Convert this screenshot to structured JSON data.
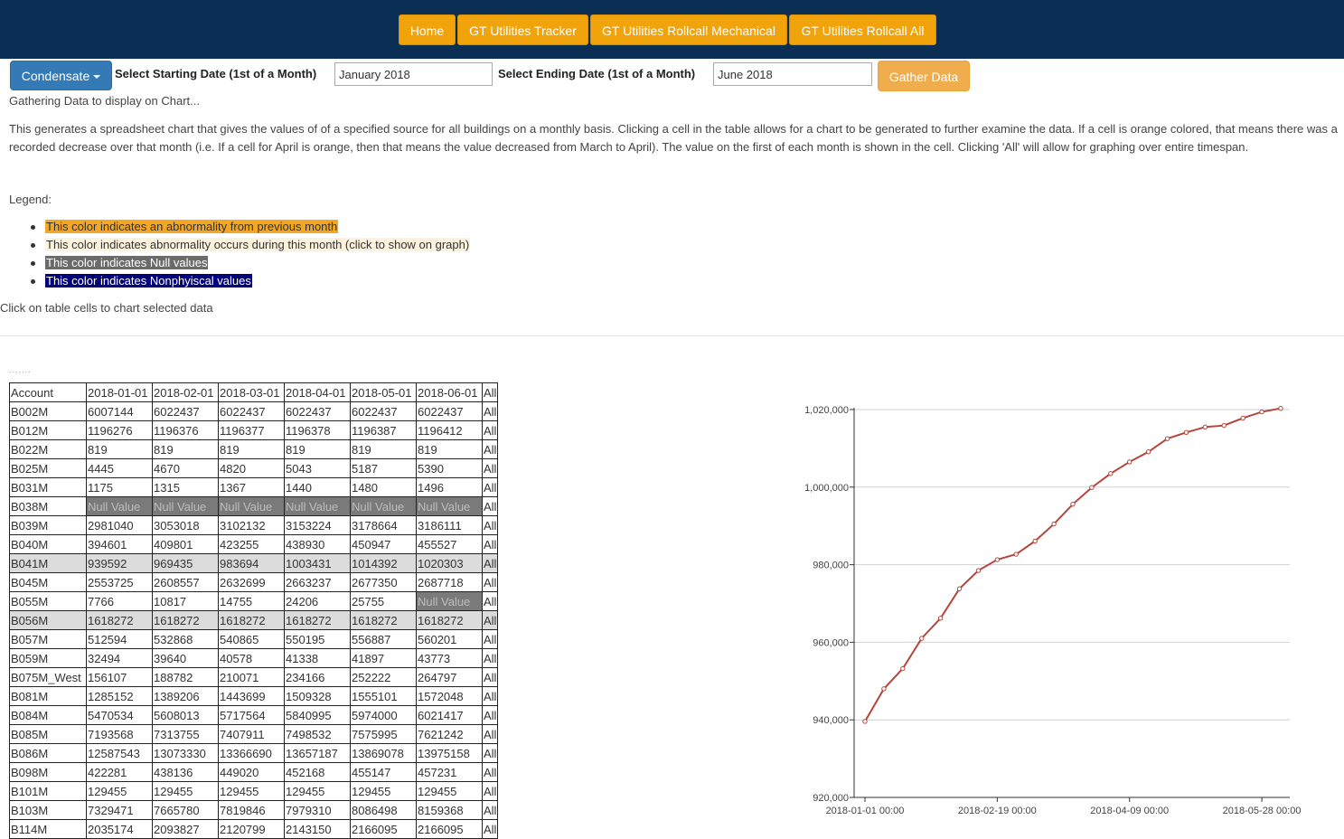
{
  "nav": {
    "items": [
      {
        "label": "Home"
      },
      {
        "label": "GT Utilities Tracker"
      },
      {
        "label": "GT Utilities Rollcall Mechanical"
      },
      {
        "label": "GT Utilities Rollcall All"
      }
    ]
  },
  "controls": {
    "condense_label": "Condensate",
    "start_label": "Select Starting Date (1st of a Month)",
    "start_value": "January 2018",
    "end_label": "Select Ending Date (1st of a Month)",
    "end_value": "June 2018",
    "gather_label": "Gather Data"
  },
  "status_text": "Gathering Data to display on Chart...",
  "description": "This generates a spreadsheet chart that gives the values of of a specified source for all buildings on a monthly basis. Clicking a cell in the table allows for a chart to be generated to further examine the data. If a cell is orange colored, that means there was a recorded decrease over that month (i.e. If a cell for April is orange, then that means the value decreased from March to April). The value on the first of each month is shown in the cell. Clicking 'All' will allow for graphing over entire timespan.",
  "legend": {
    "title": "Legend:",
    "items": [
      {
        "text": "This color indicates an abnormality from previous month",
        "bg": "#f5a623",
        "fg": "#333333"
      },
      {
        "text": "This color indicates abnormality occurs during this month (click to show on graph)",
        "bg": "#fdf3dc",
        "fg": "#333333"
      },
      {
        "text": "This color indicates Null values",
        "bg": "#6b6b6b",
        "fg": "#ffffff"
      },
      {
        "text": "This color indicates Nonphyiscal values",
        "bg": "#00007a",
        "fg": "#ffffff"
      }
    ]
  },
  "help_text": "Click on table cells to chart selected data",
  "table": {
    "headers": [
      "Account",
      "2018-01-01",
      "2018-02-01",
      "2018-03-01",
      "2018-04-01",
      "2018-05-01",
      "2018-06-01",
      "All"
    ],
    "rows": [
      {
        "account": "B002M",
        "values": [
          "6007144",
          "6022437",
          "6022437",
          "6022437",
          "6022437",
          "6022437"
        ],
        "all": "All"
      },
      {
        "account": "B012M",
        "values": [
          "1196276",
          "1196376",
          "1196377",
          "1196378",
          "1196387",
          "1196412"
        ],
        "all": "All"
      },
      {
        "account": "B022M",
        "values": [
          "819",
          "819",
          "819",
          "819",
          "819",
          "819"
        ],
        "all": "All"
      },
      {
        "account": "B025M",
        "values": [
          "4445",
          "4670",
          "4820",
          "5043",
          "5187",
          "5390"
        ],
        "all": "All"
      },
      {
        "account": "B031M",
        "values": [
          "1175",
          "1315",
          "1367",
          "1440",
          "1480",
          "1496"
        ],
        "all": "All"
      },
      {
        "account": "B038M",
        "values": [
          "Null Value",
          "Null Value",
          "Null Value",
          "Null Value",
          "Null Value",
          "Null Value"
        ],
        "all": "All"
      },
      {
        "account": "B039M",
        "values": [
          "2981040",
          "3053018",
          "3102132",
          "3153224",
          "3178664",
          "3186111"
        ],
        "all": "All"
      },
      {
        "account": "B040M",
        "values": [
          "394601",
          "409801",
          "423255",
          "438930",
          "450947",
          "455527"
        ],
        "all": "All"
      },
      {
        "account": "B041M",
        "values": [
          "939592",
          "969435",
          "983694",
          "1003431",
          "1014392",
          "1020303"
        ],
        "all": "All",
        "abnormal": true
      },
      {
        "account": "B045M",
        "values": [
          "2553725",
          "2608557",
          "2632699",
          "2663237",
          "2677350",
          "2687718"
        ],
        "all": "All"
      },
      {
        "account": "B055M",
        "values": [
          "7766",
          "10817",
          "14755",
          "24206",
          "25755",
          "Null Value"
        ],
        "all": "All"
      },
      {
        "account": "B056M",
        "values": [
          "1618272",
          "1618272",
          "1618272",
          "1618272",
          "1618272",
          "1618272"
        ],
        "all": "All",
        "abnormal": true
      },
      {
        "account": "B057M",
        "values": [
          "512594",
          "532868",
          "540865",
          "550195",
          "556887",
          "560201"
        ],
        "all": "All"
      },
      {
        "account": "B059M",
        "values": [
          "32494",
          "39640",
          "40578",
          "41338",
          "41897",
          "43773"
        ],
        "all": "All"
      },
      {
        "account": "B075M_West",
        "values": [
          "156107",
          "188782",
          "210071",
          "234166",
          "252222",
          "264797"
        ],
        "all": "All"
      },
      {
        "account": "B081M",
        "values": [
          "1285152",
          "1389206",
          "1443699",
          "1509328",
          "1555101",
          "1572048"
        ],
        "all": "All"
      },
      {
        "account": "B084M",
        "values": [
          "5470534",
          "5608013",
          "5717564",
          "5840995",
          "5974000",
          "6021417"
        ],
        "all": "All"
      },
      {
        "account": "B085M",
        "values": [
          "7193568",
          "7313755",
          "7407911",
          "7498532",
          "7575995",
          "7621242"
        ],
        "all": "All"
      },
      {
        "account": "B086M",
        "values": [
          "12587543",
          "13073330",
          "13366690",
          "13657187",
          "13869078",
          "13975158"
        ],
        "all": "All"
      },
      {
        "account": "B098M",
        "values": [
          "422281",
          "438136",
          "449020",
          "452168",
          "455147",
          "457231"
        ],
        "all": "All"
      },
      {
        "account": "B101M",
        "values": [
          "129455",
          "129455",
          "129455",
          "129455",
          "129455",
          "129455"
        ],
        "all": "All"
      },
      {
        "account": "B103M",
        "values": [
          "7329471",
          "7665780",
          "7819846",
          "7979310",
          "8086498",
          "8159368"
        ],
        "all": "All"
      },
      {
        "account": "B114M",
        "values": [
          "2035174",
          "2093827",
          "2120799",
          "2143150",
          "2166095",
          "2166095"
        ],
        "all": "All"
      }
    ]
  },
  "colors": {
    "nav_bg": "#0b2e55",
    "nav_button": "#f0a30a",
    "condense_button": "#337ab7",
    "gather_button": "#f0ad4e",
    "null_cell": "#7a7a7a",
    "abnormal_row": "#dcdcdc",
    "series_line": "#b5443a"
  },
  "chart_data": {
    "type": "line",
    "title": "",
    "xlabel": "",
    "ylabel": "",
    "ylim": [
      920000,
      1020000
    ],
    "y_ticks": [
      920000,
      940000,
      960000,
      980000,
      1000000,
      1020000
    ],
    "y_tick_labels": [
      "920,000",
      "940,000",
      "960,000",
      "980,000",
      "1,000,000",
      "1,020,000"
    ],
    "x_tick_labels": [
      "2018-01-01 00:00",
      "2018-02-19 00:00",
      "2018-04-09 00:00",
      "2018-05-28 00:00"
    ],
    "grid": true,
    "legend": "none",
    "series": [
      {
        "x": [
          "2018-01-01",
          "2018-01-08",
          "2018-01-15",
          "2018-01-22",
          "2018-01-29",
          "2018-02-05",
          "2018-02-12",
          "2018-02-19",
          "2018-02-26",
          "2018-03-05",
          "2018-03-12",
          "2018-03-19",
          "2018-03-26",
          "2018-04-02",
          "2018-04-09",
          "2018-04-16",
          "2018-04-23",
          "2018-04-30",
          "2018-05-07",
          "2018-05-14",
          "2018-05-21",
          "2018-05-28",
          "2018-06-04"
        ],
        "y": [
          939592,
          948000,
          953200,
          961000,
          966200,
          973800,
          978500,
          981300,
          982700,
          986100,
          990500,
          995600,
          999900,
          1003500,
          1006500,
          1009100,
          1012500,
          1014100,
          1015500,
          1015900,
          1017800,
          1019400,
          1020303
        ]
      }
    ]
  }
}
